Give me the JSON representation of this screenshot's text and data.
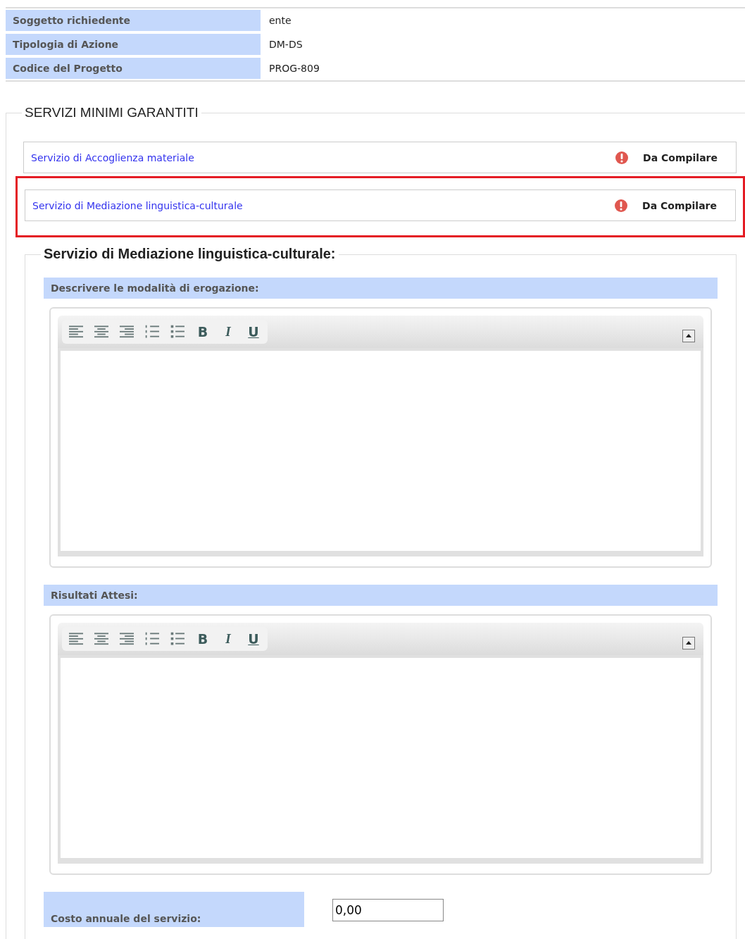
{
  "summary": [
    {
      "label": "Soggetto richiedente",
      "value": "ente"
    },
    {
      "label": "Tipologia di Azione",
      "value": "DM-DS"
    },
    {
      "label": "Codice del Progetto",
      "value": "PROG-809"
    }
  ],
  "services_section": {
    "legend": "SERVIZI MINIMI GARANTITI",
    "services": [
      {
        "name": "Servizio di Accoglienza materiale",
        "status": "Da Compilare",
        "highlighted": false
      },
      {
        "name": "Servizio di Mediazione linguistica-culturale",
        "status": "Da Compilare",
        "highlighted": true
      }
    ],
    "detail": {
      "legend": "Servizio di Mediazione linguistica-culturale:",
      "editors": [
        {
          "label": "Descrivere le modalità di erogazione:",
          "toolbar": [
            {
              "kind": "align-left"
            },
            {
              "kind": "align-center"
            },
            {
              "kind": "align-right"
            },
            {
              "kind": "ordered-list"
            },
            {
              "kind": "bullet-list"
            },
            {
              "kind": "bold",
              "label": "B"
            },
            {
              "kind": "italic",
              "label": "I"
            },
            {
              "kind": "underline",
              "label": "U"
            }
          ]
        },
        {
          "label": "Risultati Attesi:",
          "toolbar": [
            {
              "kind": "align-left"
            },
            {
              "kind": "align-center"
            },
            {
              "kind": "align-right"
            },
            {
              "kind": "ordered-list"
            },
            {
              "kind": "bullet-list"
            },
            {
              "kind": "bold",
              "label": "B"
            },
            {
              "kind": "italic",
              "label": "I"
            },
            {
              "kind": "underline",
              "label": "U"
            }
          ]
        }
      ],
      "cost": {
        "label": "Costo annuale del servizio:",
        "value": "0,00"
      }
    }
  }
}
